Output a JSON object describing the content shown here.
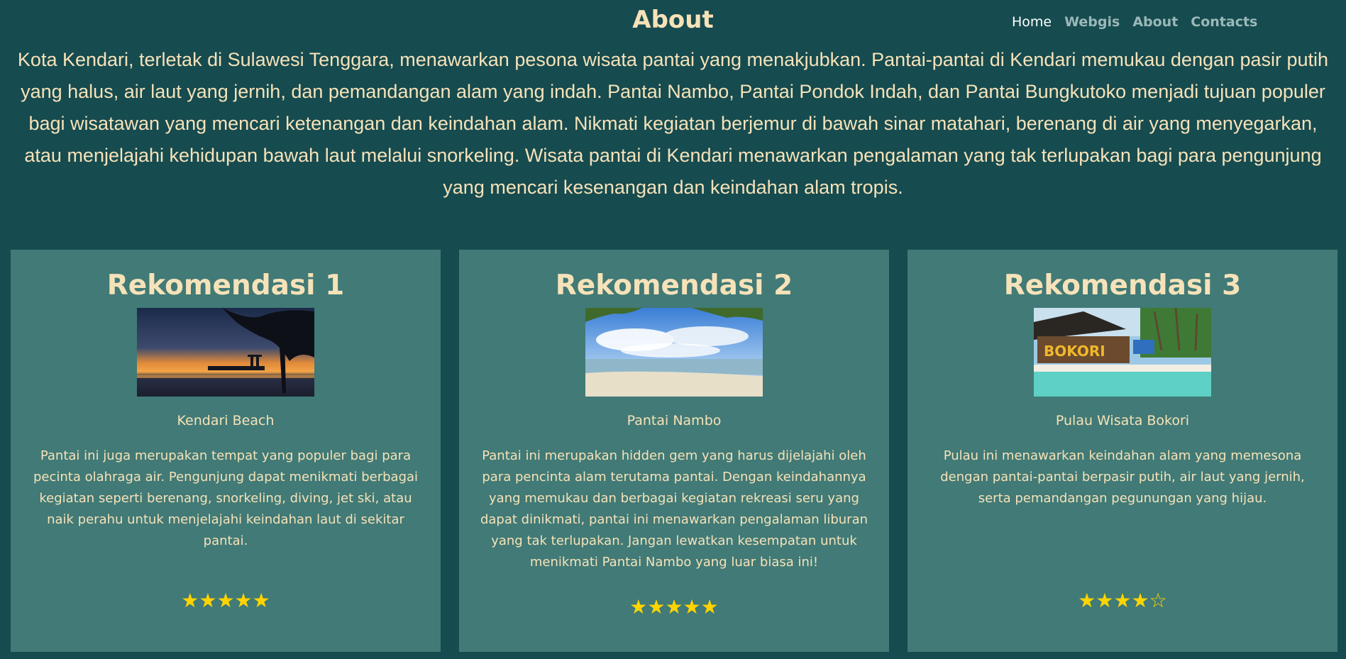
{
  "header": {
    "title": "About",
    "nav": [
      "Home",
      "Webgis",
      "About",
      "Contacts"
    ]
  },
  "intro": "Kota Kendari, terletak di Sulawesi Tenggara, menawarkan pesona wisata pantai yang menakjubkan. Pantai-pantai di Kendari memukau dengan pasir putih yang halus, air laut yang jernih, dan pemandangan alam yang indah. Pantai Nambo, Pantai Pondok Indah, dan Pantai Bungkutoko menjadi tujuan populer bagi wisatawan yang mencari ketenangan dan keindahan alam. Nikmati kegiatan berjemur di bawah sinar matahari, berenang di air yang menyegarkan, atau menjelajahi kehidupan bawah laut melalui snorkeling. Wisata pantai di Kendari menawarkan pengalaman yang tak terlupakan bagi para pengunjung yang mencari kesenangan dan keindahan alam tropis.",
  "cards": [
    {
      "title": "Rekomendasi 1",
      "name": "Kendari Beach",
      "description": "Pantai ini juga merupakan tempat yang populer bagi para pecinta olahraga air. Pengunjung dapat menikmati berbagai kegiatan seperti berenang, snorkeling, diving, jet ski, atau naik perahu untuk menjelajahi keindahan laut di sekitar pantai.",
      "rating": "★★★★★"
    },
    {
      "title": "Rekomendasi 2",
      "name": "Pantai Nambo",
      "description": "Pantai ini merupakan hidden gem yang harus dijelajahi oleh para pencinta alam terutama pantai. Dengan keindahannya yang memukau dan berbagai kegiatan rekreasi seru yang dapat dinikmati, pantai ini menawarkan pengalaman liburan yang tak terlupakan. Jangan lewatkan kesempatan untuk menikmati Pantai Nambo yang luar biasa ini!",
      "rating": "★★★★★"
    },
    {
      "title": "Rekomendasi 3",
      "name": "Pulau Wisata Bokori",
      "description": "Pulau ini menawarkan keindahan alam yang memesona dengan pantai-pantai berpasir putih, air laut yang jernih, serta pemandangan pegunungan yang hijau.",
      "rating": "★★★★☆",
      "photo_text": "BOKORI"
    }
  ]
}
